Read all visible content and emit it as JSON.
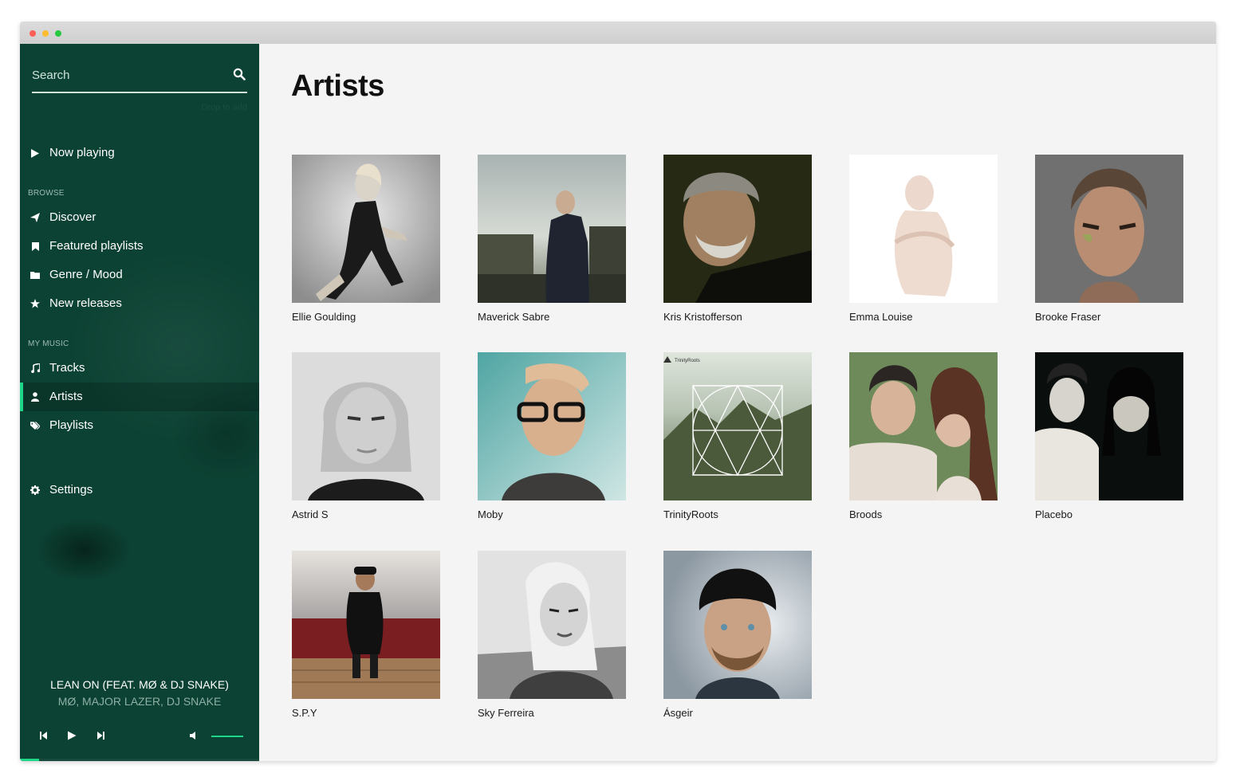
{
  "window": {
    "controls": {
      "close_color": "#ff5f57",
      "minimize_color": "#ffbd2e",
      "maximize_color": "#28c940"
    }
  },
  "colors": {
    "accent": "#1ed68a",
    "sidebar_bg": "#0c4233",
    "main_bg": "#f4f4f4"
  },
  "sidebar": {
    "search": {
      "placeholder": "Search",
      "icon": "search-icon",
      "drop_hint": "Drop to add"
    },
    "now_playing_link": {
      "label": "Now playing",
      "icon": "play-icon"
    },
    "browse_label": "BROWSE",
    "browse_items": [
      {
        "label": "Discover",
        "icon": "send-icon"
      },
      {
        "label": "Featured playlists",
        "icon": "bookmark-icon"
      },
      {
        "label": "Genre / Mood",
        "icon": "folder-icon"
      },
      {
        "label": "New releases",
        "icon": "star-icon"
      }
    ],
    "my_music_label": "MY MUSIC",
    "my_music_items": [
      {
        "label": "Tracks",
        "icon": "music-note-icon",
        "active": false
      },
      {
        "label": "Artists",
        "icon": "user-icon",
        "active": true
      },
      {
        "label": "Playlists",
        "icon": "tags-icon",
        "active": false
      }
    ],
    "settings": {
      "label": "Settings",
      "icon": "gear-icon"
    },
    "player": {
      "track_title": "LEAN ON (FEAT. MØ & DJ SNAKE)",
      "track_artist": "MØ, MAJOR LAZER, DJ SNAKE",
      "progress": 0.08,
      "volume": 1.0,
      "controls": [
        "previous-icon",
        "play-icon",
        "next-icon",
        "volume-icon"
      ]
    }
  },
  "main": {
    "title": "Artists",
    "artists": [
      {
        "name": "Ellie Goulding"
      },
      {
        "name": "Maverick Sabre"
      },
      {
        "name": "Kris Kristofferson"
      },
      {
        "name": "Emma Louise"
      },
      {
        "name": "Brooke Fraser"
      },
      {
        "name": "Astrid S"
      },
      {
        "name": "Moby"
      },
      {
        "name": "TrinityRoots",
        "cover_text": "TrinityRoots"
      },
      {
        "name": "Broods"
      },
      {
        "name": "Placebo"
      },
      {
        "name": "S.P.Y"
      },
      {
        "name": "Sky Ferreira"
      },
      {
        "name": "Ásgeir"
      }
    ]
  }
}
